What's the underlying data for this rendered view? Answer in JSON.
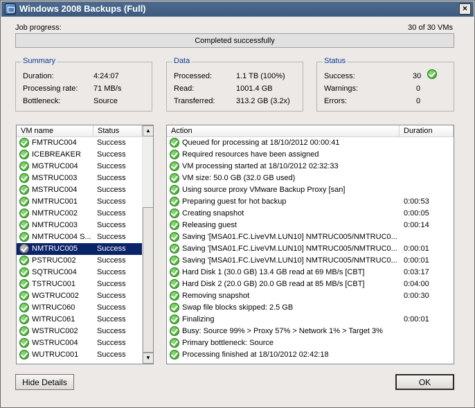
{
  "window": {
    "title": "Windows 2008 Backups (Full)"
  },
  "job": {
    "progress_label": "Job progress:",
    "vm_count": "30 of 30 VMs",
    "status_text": "Completed successfully",
    "progress_fraction": 1.0
  },
  "summary": {
    "title": "Summary",
    "rows": [
      {
        "label": "Duration:",
        "value": "4:24:07"
      },
      {
        "label": "Processing rate:",
        "value": "71 MB/s"
      },
      {
        "label": "Bottleneck:",
        "value": "Source"
      }
    ]
  },
  "data": {
    "title": "Data",
    "rows": [
      {
        "label": "Processed:",
        "value": "1.1 TB (100%)"
      },
      {
        "label": "Read:",
        "value": "1001.4 GB"
      },
      {
        "label": "Transferred:",
        "value": "313.2 GB (3.2x)"
      }
    ]
  },
  "status": {
    "title": "Status",
    "rows": [
      {
        "label": "Success:",
        "value": "30"
      },
      {
        "label": "Warnings:",
        "value": "0"
      },
      {
        "label": "Errors:",
        "value": "0"
      }
    ]
  },
  "vm_list": {
    "columns": [
      "VM name",
      "Status"
    ],
    "selected_index": 9,
    "rows": [
      {
        "name": "FMTRUC004",
        "status": "Success"
      },
      {
        "name": "ICEBREAKER",
        "status": "Success"
      },
      {
        "name": "MGTRUC004",
        "status": "Success"
      },
      {
        "name": "MSTRUC003",
        "status": "Success"
      },
      {
        "name": "MSTRUC004",
        "status": "Success"
      },
      {
        "name": "NMTRUC001",
        "status": "Success"
      },
      {
        "name": "NMTRUC002",
        "status": "Success"
      },
      {
        "name": "NMTRUC003",
        "status": "Success"
      },
      {
        "name": "NMTRUC004 S...",
        "status": "Success"
      },
      {
        "name": "NMTRUC005",
        "status": "Success"
      },
      {
        "name": "PSTRUC002",
        "status": "Success"
      },
      {
        "name": "SQTRUC004",
        "status": "Success"
      },
      {
        "name": "TSTRUC001",
        "status": "Success"
      },
      {
        "name": "WGTRUC002",
        "status": "Success"
      },
      {
        "name": "WITRUC060",
        "status": "Success"
      },
      {
        "name": "WITRUC061",
        "status": "Success"
      },
      {
        "name": "WSTRUC002",
        "status": "Success"
      },
      {
        "name": "WSTRUC004",
        "status": "Success"
      },
      {
        "name": "WUTRUC001",
        "status": "Success"
      }
    ]
  },
  "action_list": {
    "columns": [
      "Action",
      "Duration"
    ],
    "rows": [
      {
        "action": "Queued for processing at 18/10/2012 00:00:41",
        "duration": ""
      },
      {
        "action": "Required resources have been assigned",
        "duration": ""
      },
      {
        "action": "VM processing started at 18/10/2012 02:32:33",
        "duration": ""
      },
      {
        "action": "VM size: 50.0 GB (32.0 GB used)",
        "duration": ""
      },
      {
        "action": "Using source proxy VMware Backup Proxy [san]",
        "duration": ""
      },
      {
        "action": "Preparing guest for hot backup",
        "duration": "0:00:53"
      },
      {
        "action": "Creating snapshot",
        "duration": "0:00:05"
      },
      {
        "action": "Releasing guest",
        "duration": "0:00:14"
      },
      {
        "action": "Saving '[MSA01.FC.LiveVM.LUN10] NMTRUC005/NMTRUC0...",
        "duration": ""
      },
      {
        "action": "Saving '[MSA01.FC.LiveVM.LUN10] NMTRUC005/NMTRUC0...",
        "duration": "0:00:01"
      },
      {
        "action": "Saving '[MSA01.FC.LiveVM.LUN10] NMTRUC005/NMTRUC0...",
        "duration": "0:00:01"
      },
      {
        "action": "Hard Disk 1 (30.0 GB) 13.4 GB read at 69 MB/s [CBT]",
        "duration": "0:03:17"
      },
      {
        "action": "Hard Disk 2 (20.0 GB) 20.0 GB read at 85 MB/s [CBT]",
        "duration": "0:04:00"
      },
      {
        "action": "Removing snapshot",
        "duration": "0:00:30"
      },
      {
        "action": "Swap file blocks skipped: 2.5 GB",
        "duration": ""
      },
      {
        "action": "Finalizing",
        "duration": "0:00:01"
      },
      {
        "action": "Busy: Source 99% > Proxy 57% > Network 1% > Target 3%",
        "duration": ""
      },
      {
        "action": "Primary bottleneck: Source",
        "duration": ""
      },
      {
        "action": "Processing finished at 18/10/2012 02:42:18",
        "duration": ""
      }
    ]
  },
  "buttons": {
    "hide_details": "Hide Details",
    "ok": "OK",
    "close": "×"
  },
  "icons": {
    "success": "check-circle-icon",
    "scroll_up": "▲",
    "scroll_down": "▼"
  },
  "colors": {
    "group_title": "#0a3c92",
    "selection": "#0a246a",
    "success_green": "#2e9a1e"
  }
}
